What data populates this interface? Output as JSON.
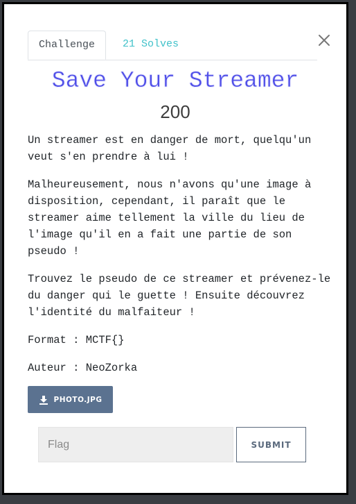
{
  "modal": {
    "close_icon": "close-icon",
    "tabs": [
      {
        "label": "Challenge",
        "active": true
      },
      {
        "label": "21 Solves",
        "active": false
      }
    ],
    "title": "Save Your Streamer",
    "points": "200",
    "description": [
      "Un streamer est en danger de mort, quelqu'un veut s'en prendre à lui !",
      "Malheureusement, nous n'avons qu'une image à disposition, cependant, il paraît que le streamer aime tellement la ville du lieu de l'image qu'il en a fait une partie de son pseudo !",
      "Trouvez le pseudo de ce streamer et prévenez-le du danger qui le guette ! Ensuite découvrez l'identité du malfaiteur !",
      "Format : MCTF{}",
      "Auteur : NeoZorka"
    ],
    "download": {
      "icon": "download-icon",
      "label": "PHOTO.JPG"
    },
    "flag_input": {
      "placeholder": "Flag",
      "value": ""
    },
    "submit_label": "SUBMIT"
  },
  "colors": {
    "title": "#4f4ee8",
    "tab_inactive": "#3fc1c9",
    "button_bg": "#5b7290",
    "submit_border": "#5b6a7d"
  }
}
